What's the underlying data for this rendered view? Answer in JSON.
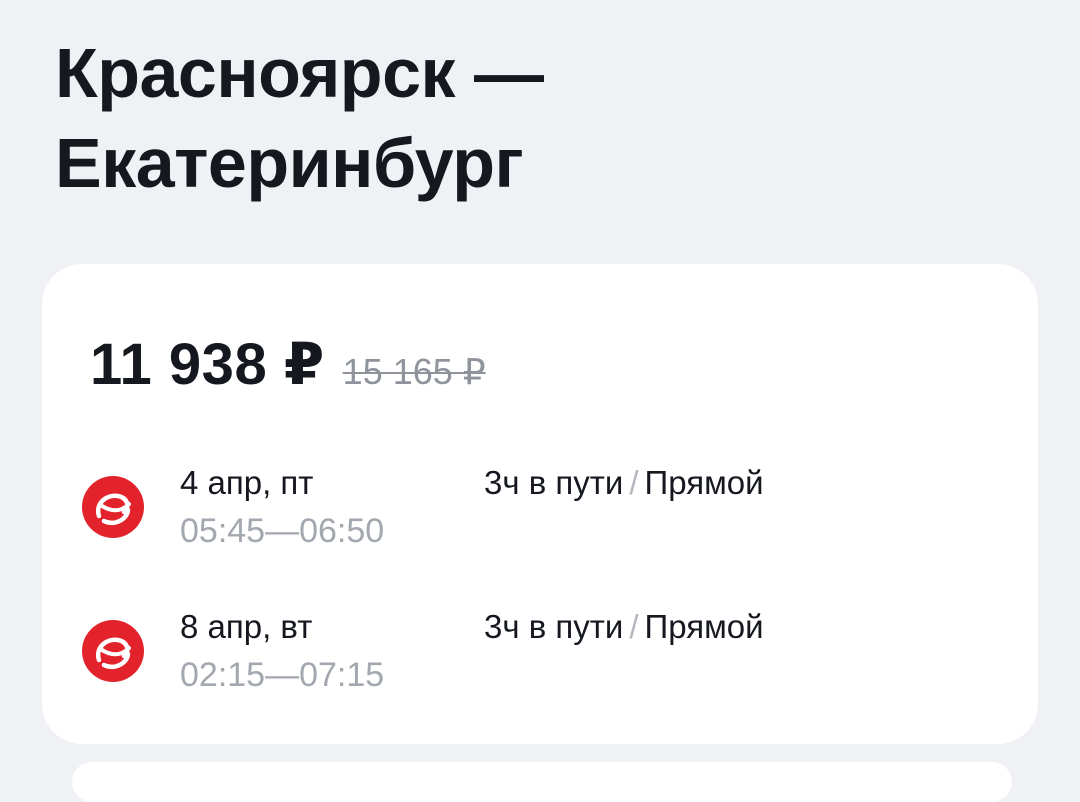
{
  "route": {
    "line1": "Красноярск —",
    "line2": "Екатеринбург"
  },
  "offer": {
    "price": "11 938 ₽",
    "old_price": "15 165 ₽",
    "segments": [
      {
        "date": "4 апр, пт",
        "times": "05:45—06:50",
        "duration": "3ч в пути",
        "separator": "/",
        "stops": "Прямой",
        "airline_icon": "red-swirl-airline-logo"
      },
      {
        "date": "8 апр, вт",
        "times": "02:15—07:15",
        "duration": "3ч в пути",
        "separator": "/",
        "stops": "Прямой",
        "airline_icon": "red-swirl-airline-logo"
      }
    ]
  },
  "colors": {
    "background": "#eff1f5",
    "card": "#ffffff",
    "airline_red": "#e3232c",
    "muted_text": "#a3a8b0"
  }
}
